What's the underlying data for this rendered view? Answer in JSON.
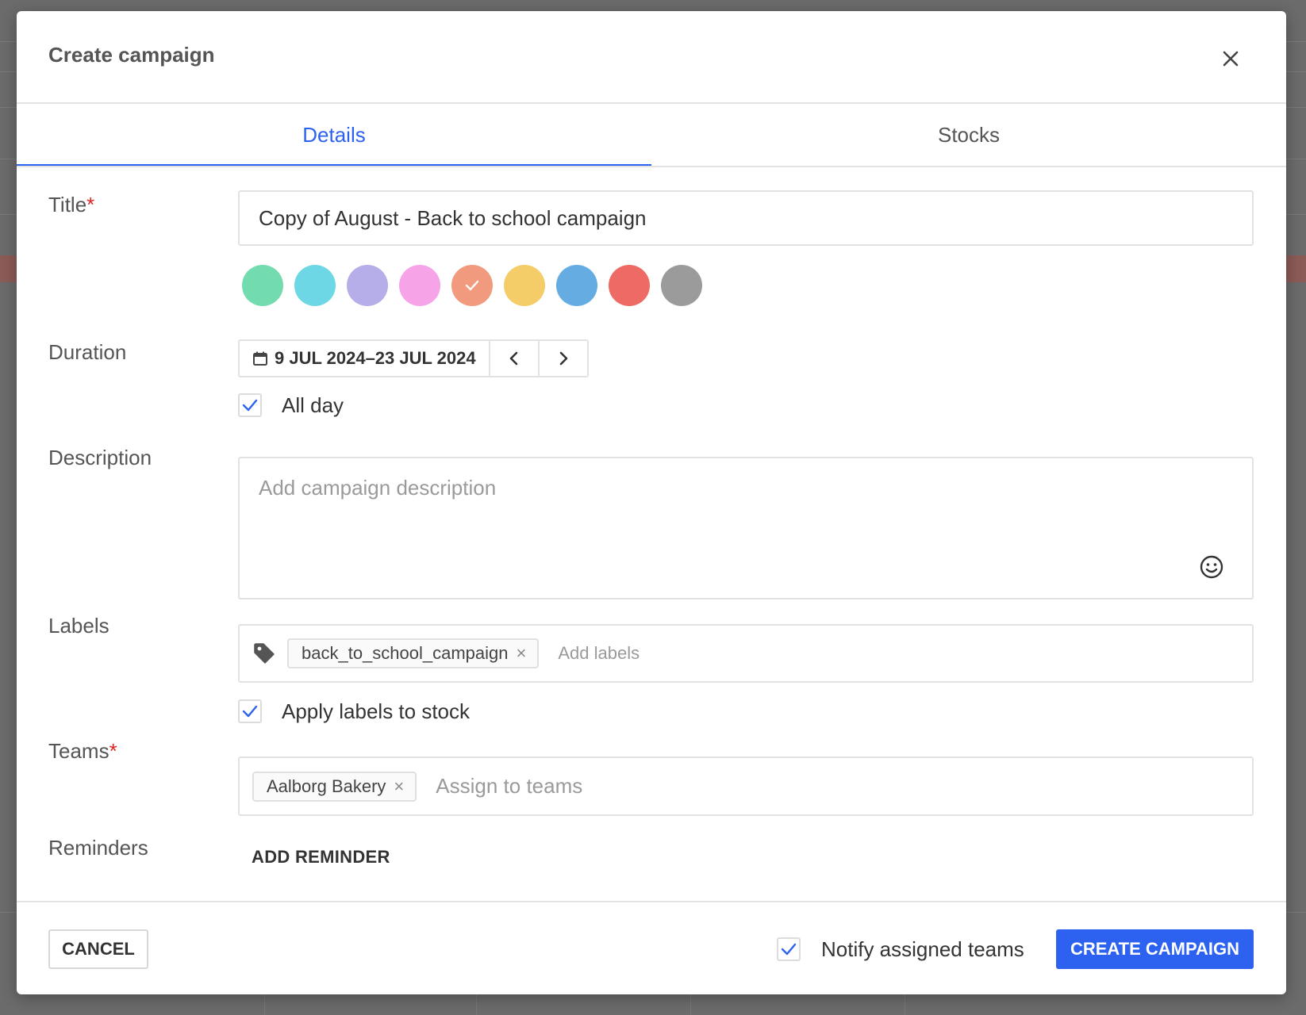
{
  "modal": {
    "title": "Create campaign"
  },
  "tabs": [
    {
      "label": "Details",
      "active": true
    },
    {
      "label": "Stocks",
      "active": false
    }
  ],
  "form": {
    "title_label": "Title",
    "required_mark": "*",
    "title_value": "Copy of August - Back to school campaign",
    "colors": [
      "#72dcaf",
      "#6dd7e5",
      "#b5aee8",
      "#f7a3e7",
      "#f29a7d",
      "#f4cd68",
      "#64ace2",
      "#ed6b64",
      "#9b9b9b"
    ],
    "selected_color_index": 4,
    "duration_label": "Duration",
    "date_range": "9 JUL 2024–23 JUL 2024",
    "all_day_label": "All day",
    "all_day_checked": true,
    "description_label": "Description",
    "description_placeholder": "Add campaign description",
    "labels_label": "Labels",
    "label_chips": [
      "back_to_school_campaign"
    ],
    "labels_placeholder": "Add labels",
    "apply_labels_label": "Apply labels to stock",
    "apply_labels_checked": true,
    "teams_label": "Teams",
    "team_chips": [
      "Aalborg Bakery"
    ],
    "teams_placeholder": "Assign to teams",
    "reminders_label": "Reminders",
    "add_reminder": "ADD REMINDER"
  },
  "footer": {
    "cancel": "CANCEL",
    "notify_label": "Notify assigned teams",
    "notify_checked": true,
    "create": "CREATE CAMPAIGN"
  },
  "accent_color": "#2d62f0",
  "required_color": "#e02424"
}
